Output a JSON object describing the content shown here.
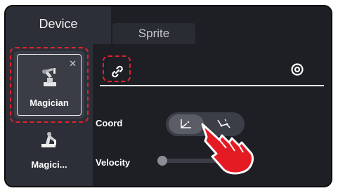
{
  "tabs": {
    "device": "Device",
    "sprite": "Sprite"
  },
  "devices": [
    {
      "label": "Magician",
      "icon": "robot-arm-icon",
      "selected": true
    },
    {
      "label": "Magici...",
      "icon": "robot-arm-icon",
      "selected": false
    }
  ],
  "connection": {
    "link_icon": "link-icon",
    "target_icon": "target-icon"
  },
  "coord": {
    "label": "Coord",
    "options": [
      "cartesian-coord-icon",
      "joint-coord-icon"
    ],
    "active_index": 0
  },
  "velocity": {
    "label": "Velocity",
    "value_fraction": 0.0
  },
  "colors": {
    "highlight": "#e0232d",
    "panel": "#2c2f37",
    "background": "#1d1f25"
  }
}
